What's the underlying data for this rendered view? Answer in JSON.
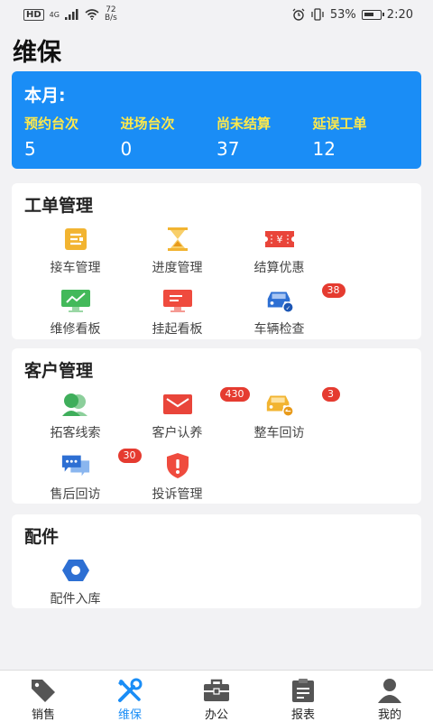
{
  "status_bar": {
    "hd": "HD",
    "signal": "4G",
    "net_speed_value": "72",
    "net_speed_unit": "B/s",
    "battery": "53%",
    "time": "2:20"
  },
  "page_title": "维保",
  "summary": {
    "title": "本月:",
    "stats": [
      {
        "label": "预约台次",
        "value": "5"
      },
      {
        "label": "进场台次",
        "value": "0"
      },
      {
        "label": "尚未结算",
        "value": "37"
      },
      {
        "label": "延误工单",
        "value": "12"
      }
    ],
    "colors": {
      "background": "#1a8df6",
      "label": "#ffe94a"
    }
  },
  "work_orders": {
    "title": "工单管理",
    "items": [
      {
        "label": "接车管理",
        "icon": "car-reception-icon"
      },
      {
        "label": "进度管理",
        "icon": "hourglass-icon"
      },
      {
        "label": "结算优惠",
        "icon": "coupon-icon"
      },
      {
        "label": "维修看板",
        "icon": "monitor-chart-icon"
      },
      {
        "label": "挂起看板",
        "icon": "monitor-icon"
      },
      {
        "label": "车辆检查",
        "icon": "car-check-icon",
        "badge": "38"
      }
    ]
  },
  "customers": {
    "title": "客户管理",
    "items": [
      {
        "label": "拓客线索",
        "icon": "users-icon"
      },
      {
        "label": "客户认养",
        "icon": "envelope-icon",
        "badge": "430"
      },
      {
        "label": "整车回访",
        "icon": "car-return-icon",
        "badge": "3"
      },
      {
        "label": "售后回访",
        "icon": "chat-icon",
        "badge": "30"
      },
      {
        "label": "投诉管理",
        "icon": "warning-shield-icon"
      }
    ]
  },
  "parts": {
    "title": "配件",
    "items": [
      {
        "label": "配件入库",
        "icon": "hex-nut-icon"
      }
    ]
  },
  "tabbar": {
    "tabs": [
      {
        "label": "销售",
        "icon": "tag-icon"
      },
      {
        "label": "维保",
        "icon": "tools-icon",
        "active": true
      },
      {
        "label": "办公",
        "icon": "briefcase-icon"
      },
      {
        "label": "报表",
        "icon": "clipboard-icon"
      },
      {
        "label": "我的",
        "icon": "person-icon"
      }
    ],
    "active_color": "#1a8df6"
  }
}
